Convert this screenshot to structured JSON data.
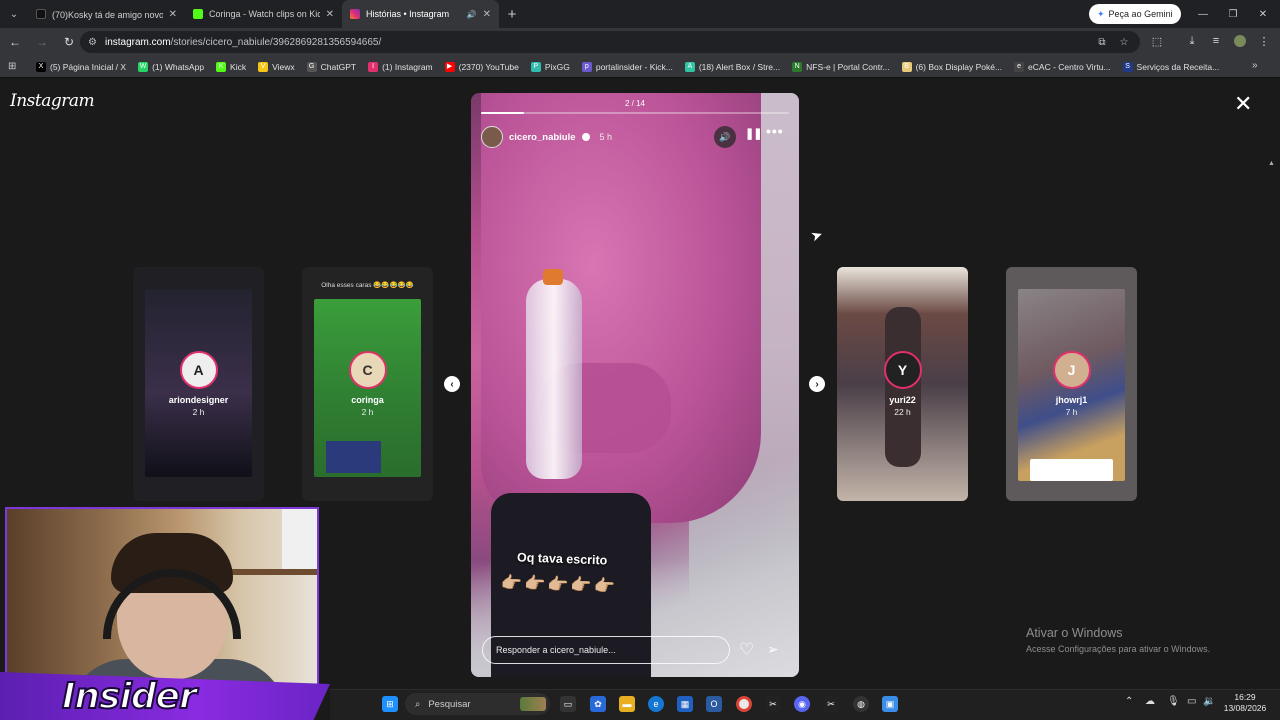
{
  "browser": {
    "tabs": [
      {
        "title": "(70)Kosky tá de amigo novo? ⓒ",
        "icon_color": "#1f1f1f",
        "active": false
      },
      {
        "title": "Coringa - Watch clips on Kick",
        "icon_color": "#53fc18",
        "active": false
      },
      {
        "title": "Histórias • Instagram",
        "icon_color": "#e1306c",
        "active": true
      }
    ],
    "new_tab_symbol": "+",
    "gemini_label": "Peça ao Gemini",
    "url_domain": "instagram.com",
    "url_path": "/stories/cicero_nabiule/3962869281356594665/",
    "bookmarks": [
      {
        "label": "(5) Página Inicial / X",
        "icon": "X",
        "color": "#000000"
      },
      {
        "label": "(1) WhatsApp",
        "icon": "W",
        "color": "#25d366"
      },
      {
        "label": "Kick",
        "icon": "K",
        "color": "#53fc18"
      },
      {
        "label": "Viewx",
        "icon": "V",
        "color": "#f5c518"
      },
      {
        "label": "ChatGPT",
        "icon": "G",
        "color": "#555555"
      },
      {
        "label": "(1) Instagram",
        "icon": "I",
        "color": "#e1306c"
      },
      {
        "label": "(2370) YouTube",
        "icon": "▶",
        "color": "#ff0000"
      },
      {
        "label": "PixGG",
        "icon": "P",
        "color": "#32bcad"
      },
      {
        "label": "portalinsider - Kick...",
        "icon": "p",
        "color": "#6a5acd"
      },
      {
        "label": "(18) Alert Box / Stre...",
        "icon": "A",
        "color": "#31c3a2"
      },
      {
        "label": "NFS-e | Portal Contr...",
        "icon": "N",
        "color": "#2b7a2b"
      },
      {
        "label": "(6) Box Display Poké...",
        "icon": "B",
        "color": "#e8c97a"
      },
      {
        "label": "eCAC - Centro Virtu...",
        "icon": "e",
        "color": "#444444"
      },
      {
        "label": "Serviços da Receita...",
        "icon": "S",
        "color": "#1f3a8a"
      }
    ]
  },
  "page": {
    "logo": "Instagram",
    "side_stories": [
      {
        "user": "ariondesigner",
        "age": "2 h",
        "caption": "",
        "bg": "#2a2a35",
        "avatar": "A"
      },
      {
        "user": "coringa",
        "age": "2 h",
        "caption": "Olha esses caras 😂😂😂😂😂",
        "bg": "#2f7d32",
        "avatar": "C"
      },
      {
        "user": "yuri22",
        "age": "22 h",
        "caption": "",
        "bg": "#5a4a4a",
        "avatar": "Y"
      },
      {
        "user": "jhowrj1",
        "age": "7 h",
        "caption": "",
        "bg": "#6a6468",
        "avatar": "J"
      }
    ],
    "story": {
      "counter": "2 / 14",
      "progress": 0.14,
      "user": "cicero_nabiule",
      "age": "5 h",
      "overlay_text": "Oq tava escrito",
      "overlay_emoji": "👉🏼👉🏼👉🏼👉🏼👉🏼",
      "reply_placeholder": "Responder a cicero_nabiule..."
    }
  },
  "windows": {
    "watermark_title": "Ativar o Windows",
    "watermark_sub": "Acesse Configurações para ativar o Windows.",
    "search_placeholder": "Pesquisar",
    "time": "16:29",
    "date": "13/08/2026"
  },
  "overlay": {
    "brand": "Insider"
  }
}
